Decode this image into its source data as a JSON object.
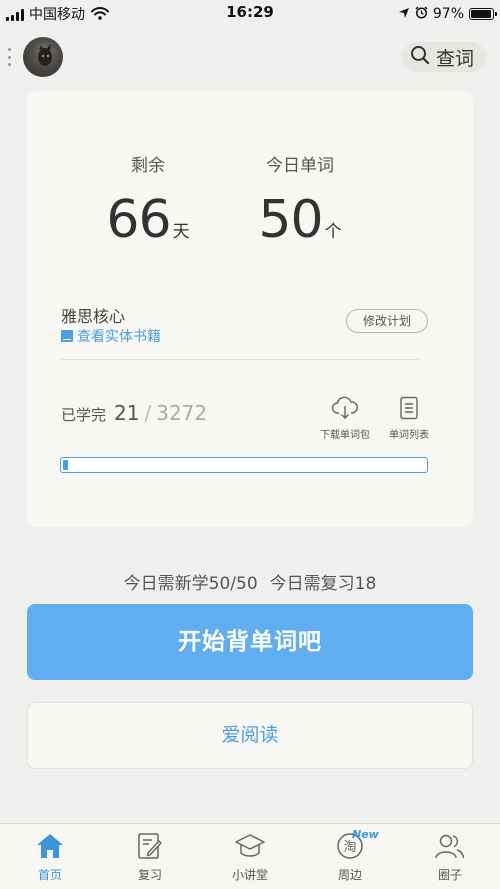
{
  "status_bar": {
    "carrier": "中国移动",
    "time": "16:29",
    "battery": "97%",
    "battery_level": 0.97
  },
  "header": {
    "search_label": "查词"
  },
  "plan_card": {
    "remaining_label": "剩余",
    "remaining_value": "66",
    "remaining_unit": "天",
    "today_label": "今日单词",
    "today_value": "50",
    "today_unit": "个",
    "book_name": "雅思核心",
    "book_link": "查看实体书籍",
    "edit_plan_label": "修改计划",
    "learned_label": "已学完",
    "learned_count": "21",
    "separator": "/",
    "total_count": "3272",
    "download_label": "下载单词包",
    "wordlist_label": "单词列表",
    "progress_fraction": 0.0064
  },
  "summary": {
    "new_text": "今日需新学50/50",
    "review_text": "今日需复习18"
  },
  "actions": {
    "start_label": "开始背单词吧",
    "read_label": "爱阅读"
  },
  "tabbar": {
    "items": [
      {
        "label": "首页",
        "icon": "home-icon",
        "active": true
      },
      {
        "label": "复习",
        "icon": "review-icon"
      },
      {
        "label": "小讲堂",
        "icon": "graduation-cap-icon"
      },
      {
        "label": "周边",
        "icon": "taobao-icon",
        "badge": "New"
      },
      {
        "label": "圈子",
        "icon": "people-icon"
      }
    ]
  },
  "colors": {
    "accent": "#4a9ee2",
    "start_button": "#60aeef",
    "background": "#efefed",
    "card": "#f8f7f3"
  }
}
